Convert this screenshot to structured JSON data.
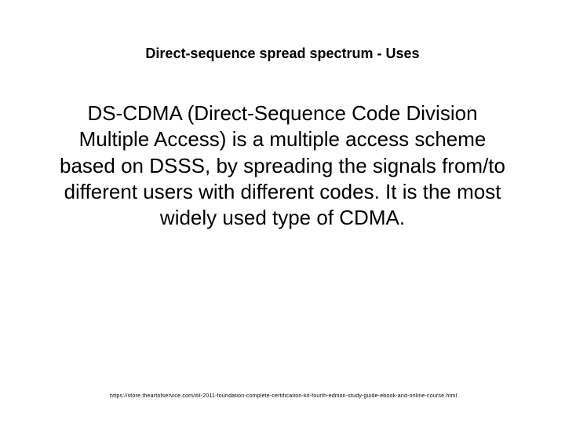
{
  "slide": {
    "title": "Direct-sequence spread spectrum - Uses",
    "body": "DS-CDMA (Direct-Sequence Code Division Multiple Access) is a multiple access scheme based on DSSS, by spreading the signals from/to different users with different codes. It is the most widely used type of CDMA.",
    "footer": "https://store.theartofservice.com/itil-2011-foundation-complete-certification-kit-fourth-edition-study-guide-ebook-and-online-course.html"
  }
}
